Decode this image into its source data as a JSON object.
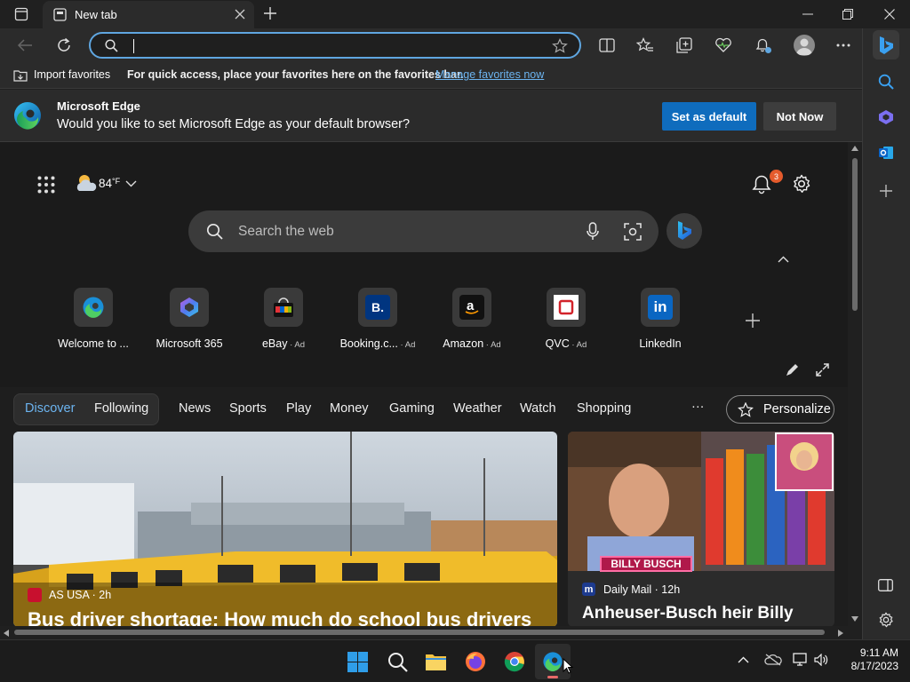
{
  "browser": {
    "tab_title": "New tab",
    "address_value": ""
  },
  "favorites_bar": {
    "import_label": "Import favorites",
    "hint": "For quick access, place your favorites here on the favorites bar.",
    "manage_link": "Manage favorites now"
  },
  "banner": {
    "title": "Microsoft Edge",
    "message": "Would you like to set Microsoft Edge as your default browser?",
    "set_default": "Set as default",
    "not_now": "Not Now"
  },
  "newtab": {
    "weather_temp": "84",
    "weather_unit": "°F",
    "notif_count": "3",
    "search_placeholder": "Search the web",
    "quick_links": [
      {
        "label": "Welcome to ...",
        "ad": ""
      },
      {
        "label": "Microsoft 365",
        "ad": ""
      },
      {
        "label": "eBay",
        "ad": " · Ad"
      },
      {
        "label": "Booking.c...",
        "ad": " · Ad"
      },
      {
        "label": "Amazon",
        "ad": " · Ad"
      },
      {
        "label": "QVC",
        "ad": " · Ad"
      },
      {
        "label": "LinkedIn",
        "ad": ""
      }
    ],
    "feed_tabs": {
      "discover": "Discover",
      "following": "Following",
      "items": [
        "News",
        "Sports",
        "Play",
        "Money",
        "Gaming",
        "Weather",
        "Watch",
        "Shopping"
      ],
      "more": "···",
      "personalize": "Personalize"
    },
    "cards": [
      {
        "source": "AS USA",
        "age": "2h",
        "headline": "Bus driver shortage: How much do school bus drivers"
      },
      {
        "source": "Daily Mail",
        "age": "12h",
        "headline": "Anheuser-Busch heir Billy",
        "image_caption": "BILLY BUSCH"
      }
    ]
  },
  "taskbar": {
    "time": "9:11 AM",
    "date": "8/17/2023"
  },
  "colors": {
    "accent": "#0f6cbd",
    "link": "#6cb4f0",
    "badge": "#e55b2c"
  }
}
